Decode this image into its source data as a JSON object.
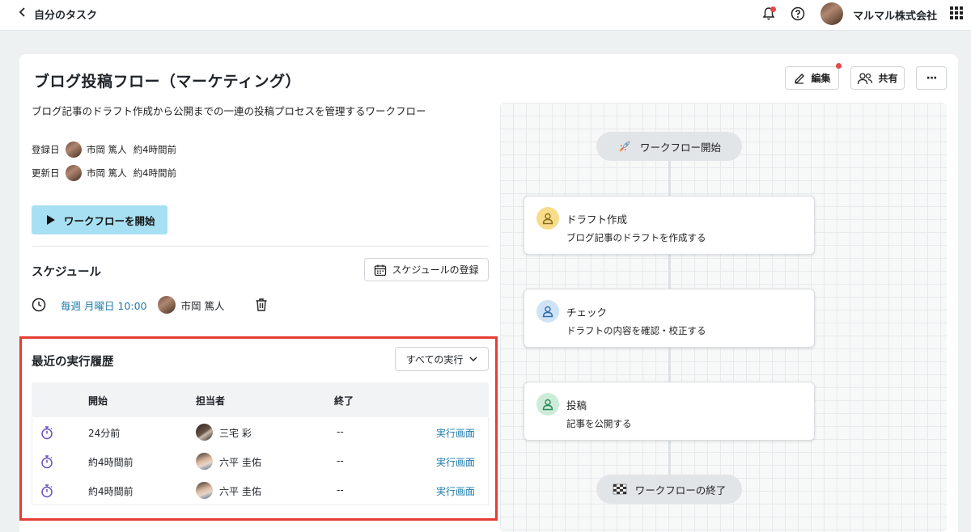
{
  "header": {
    "back_title": "自分のタスク",
    "company": "マルマル株式会社"
  },
  "workflow": {
    "title": "ブログ投稿フロー（マーケティング）",
    "description": "ブログ記事のドラフト作成から公開までの一連の投稿プロセスを管理するワークフロー",
    "edit_label": "編集",
    "share_label": "共有",
    "more_label": "···",
    "registered": {
      "label": "登録日",
      "user": "市岡 篤人",
      "time": "約4時間前"
    },
    "updated": {
      "label": "更新日",
      "user": "市岡 篤人",
      "time": "約4時間前"
    },
    "start_label": "ワークフローを開始"
  },
  "schedule": {
    "heading": "スケジュール",
    "register_label": "スケジュールの登録",
    "recurrence": "毎週 月曜日 10:00",
    "user": "市岡 篤人"
  },
  "history": {
    "heading": "最近の実行履歴",
    "filter_label": "すべての実行",
    "columns": [
      "開始",
      "担当者",
      "終了"
    ],
    "rows": [
      {
        "start": "24分前",
        "assignee": "三宅 彩",
        "end": "--",
        "link": "実行画面"
      },
      {
        "start": "約4時間前",
        "assignee": "六平 圭佑",
        "end": "--",
        "link": "実行画面"
      },
      {
        "start": "約4時間前",
        "assignee": "六平 圭佑",
        "end": "--",
        "link": "実行画面"
      }
    ]
  },
  "canvas": {
    "start_label": "ワークフロー開始",
    "end_label": "ワークフローの終了",
    "steps": [
      {
        "title": "ドラフト作成",
        "desc": "ブログ記事のドラフトを作成する",
        "color": "#f7dc8a",
        "icon_color": "#8a6d1a"
      },
      {
        "title": "チェック",
        "desc": "ドラフトの内容を確認・校正する",
        "color": "#cfe3f7",
        "icon_color": "#2f6ea8"
      },
      {
        "title": "投稿",
        "desc": "記事を公開する",
        "color": "#cdebd9",
        "icon_color": "#2c8a5a"
      }
    ]
  },
  "colors": {
    "accent": "#1f7bab",
    "start_button": "#a8e0f3",
    "highlight_border": "#e53d33",
    "timer_icon": "#6a4fc2"
  }
}
